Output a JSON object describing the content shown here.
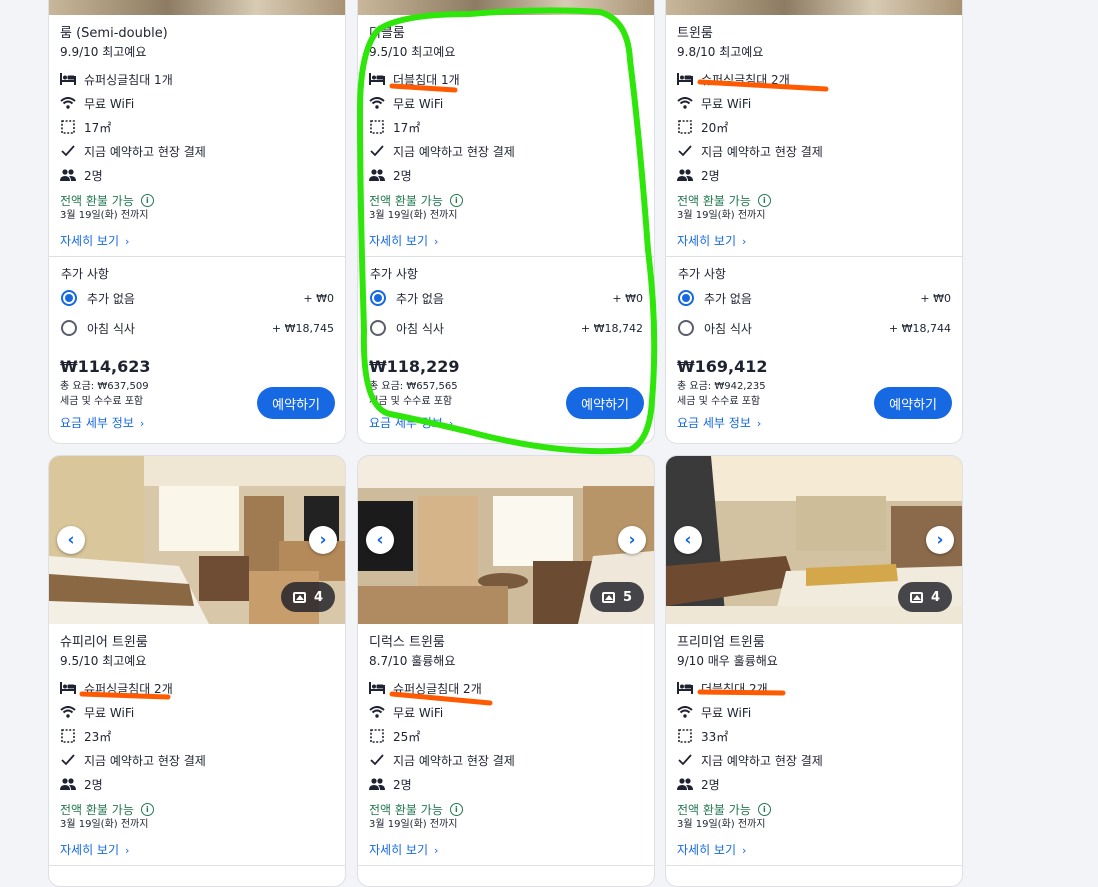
{
  "accent": "#1668e3",
  "refund_color": "#227950",
  "annotation_colors": {
    "marker": "#ff5a00",
    "circle": "#2ee60a"
  },
  "cards_top": [
    {
      "name": "룸 (Semi-double)",
      "rating": "9.9/10 최고예요",
      "bed": "슈퍼싱글침대 1개",
      "wifi": "무료 WiFi",
      "area": "17㎡",
      "payment": "지금 예약하고 현장 결제",
      "guests": "2명",
      "refund": "전액 환불 가능",
      "deadline": "3월 19일(화) 전까지",
      "more": "자세히 보기",
      "extras_title": "추가 사항",
      "opt1": "추가 없음",
      "opt1_price": "+ ₩0",
      "opt2": "아침 식사",
      "opt2_price": "+ ₩18,745",
      "nightly": "₩114,623",
      "total": "총 요금: ₩637,509",
      "tax": "세금 및 수수료 포함",
      "price_link": "요금 세부 정보",
      "reserve": "예약하기"
    },
    {
      "name": "더블룸",
      "rating": "9.5/10 최고예요",
      "bed": "더블침대 1개",
      "wifi": "무료 WiFi",
      "area": "17㎡",
      "payment": "지금 예약하고 현장 결제",
      "guests": "2명",
      "refund": "전액 환불 가능",
      "deadline": "3월 19일(화) 전까지",
      "more": "자세히 보기",
      "extras_title": "추가 사항",
      "opt1": "추가 없음",
      "opt1_price": "+ ₩0",
      "opt2": "아침 식사",
      "opt2_price": "+ ₩18,742",
      "nightly": "₩118,229",
      "total": "총 요금: ₩657,565",
      "tax": "세금 및 수수료 포함",
      "price_link": "요금 세부 정보",
      "reserve": "예약하기"
    },
    {
      "name": "트윈룸",
      "rating": "9.8/10 최고예요",
      "bed": "슈퍼싱글침대 2개",
      "wifi": "무료 WiFi",
      "area": "20㎡",
      "payment": "지금 예약하고 현장 결제",
      "guests": "2명",
      "refund": "전액 환불 가능",
      "deadline": "3월 19일(화) 전까지",
      "more": "자세히 보기",
      "extras_title": "추가 사항",
      "opt1": "추가 없음",
      "opt1_price": "+ ₩0",
      "opt2": "아침 식사",
      "opt2_price": "+ ₩18,744",
      "nightly": "₩169,412",
      "total": "총 요금: ₩942,235",
      "tax": "세금 및 수수료 포함",
      "price_link": "요금 세부 정보",
      "reserve": "예약하기"
    }
  ],
  "cards_bottom": [
    {
      "photo_count": "4",
      "name": "슈피리어 트윈룸",
      "rating": "9.5/10 최고예요",
      "bed": "슈퍼싱글침대 2개",
      "wifi": "무료 WiFi",
      "area": "23㎡",
      "payment": "지금 예약하고 현장 결제",
      "guests": "2명",
      "refund": "전액 환불 가능",
      "deadline": "3월 19일(화) 전까지",
      "more": "자세히 보기"
    },
    {
      "photo_count": "5",
      "name": "디럭스 트윈룸",
      "rating": "8.7/10 훌륭해요",
      "bed": "슈퍼싱글침대 2개",
      "wifi": "무료 WiFi",
      "area": "25㎡",
      "payment": "지금 예약하고 현장 결제",
      "guests": "2명",
      "refund": "전액 환불 가능",
      "deadline": "3월 19일(화) 전까지",
      "more": "자세히 보기"
    },
    {
      "photo_count": "4",
      "name": "프리미엄 트윈룸",
      "rating": "9/10 매우 훌륭해요",
      "bed": "더블침대 2개",
      "wifi": "무료 WiFi",
      "area": "33㎡",
      "payment": "지금 예약하고 현장 결제",
      "guests": "2명",
      "refund": "전액 환불 가능",
      "deadline": "3월 19일(화) 전까지",
      "more": "자세히 보기"
    }
  ]
}
